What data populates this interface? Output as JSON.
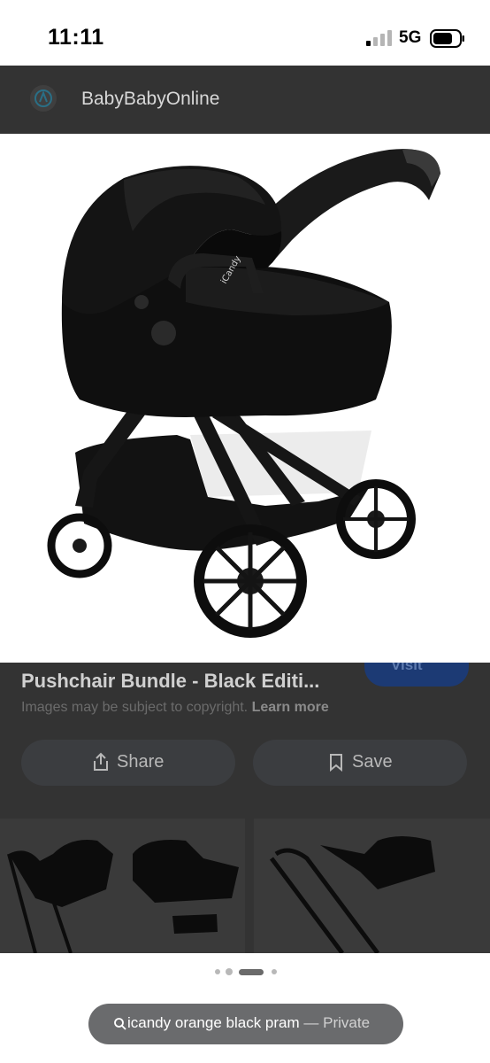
{
  "status_bar": {
    "time": "11:11",
    "network": "5G",
    "battery_icon": "battery-icon"
  },
  "header": {
    "site_name": "BabyBabyOnline",
    "logo_icon": "site-logo-icon"
  },
  "hero_image": {
    "description_icon": "pram-image",
    "brand_text": "iCandy"
  },
  "result": {
    "title": "Pushchair Bundle - Black Editi...",
    "visit_label": "Visit",
    "copyright_text": "Images may be subject to copyright.",
    "learn_more": "Learn more",
    "share_label": "Share",
    "save_label": "Save"
  },
  "carousel": {
    "page_count": 5,
    "active_index": 2
  },
  "search": {
    "query": "icandy orange black pram",
    "separator": "—",
    "mode": "Private"
  },
  "colors": {
    "dim_overlay": "#333333",
    "pill": "#6a6b6d",
    "accent_blue": "#1c3a74"
  }
}
